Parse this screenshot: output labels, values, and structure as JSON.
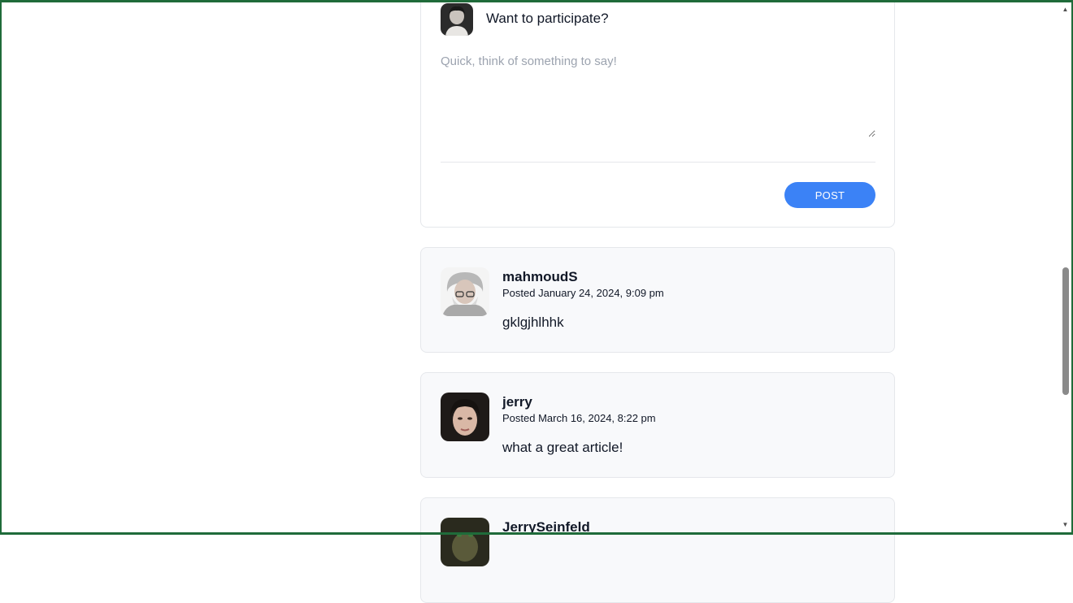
{
  "composer": {
    "prompt": "Want to participate?",
    "placeholder": "Quick, think of something to say!",
    "value": "",
    "post_label": "POST"
  },
  "comments": [
    {
      "author": "mahmoudS",
      "posted": "Posted January 24, 2024, 9:09 pm",
      "text": "gklgjhlhhk"
    },
    {
      "author": "jerry",
      "posted": "Posted March 16, 2024, 8:22 pm",
      "text": "what a great article!"
    },
    {
      "author": "JerrySeinfeld",
      "posted": "",
      "text": ""
    }
  ],
  "colors": {
    "accent": "#3b82f6",
    "card_background": "#f8f9fb",
    "border": "#e5e7eb",
    "frame": "#1f6b3a"
  },
  "icons": {
    "scroll_up": "triangle-up-icon",
    "scroll_down": "triangle-down-icon"
  }
}
